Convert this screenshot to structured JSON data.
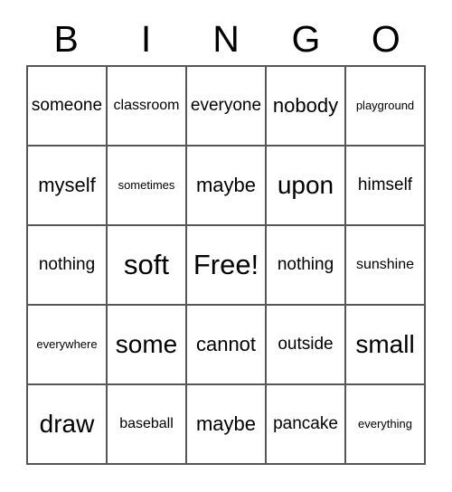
{
  "card": {
    "headers": [
      "B",
      "I",
      "N",
      "G",
      "O"
    ],
    "rows": [
      [
        {
          "text": "someone",
          "size": "m"
        },
        {
          "text": "classroom",
          "size": "s"
        },
        {
          "text": "everyone",
          "size": "m"
        },
        {
          "text": "nobody",
          "size": "l"
        },
        {
          "text": "playground",
          "size": "xs"
        }
      ],
      [
        {
          "text": "myself",
          "size": "l"
        },
        {
          "text": "sometimes",
          "size": "xs"
        },
        {
          "text": "maybe",
          "size": "l"
        },
        {
          "text": "upon",
          "size": "xl"
        },
        {
          "text": "himself",
          "size": "m"
        }
      ],
      [
        {
          "text": "nothing",
          "size": "m"
        },
        {
          "text": "soft",
          "size": "xxl"
        },
        {
          "text": "Free!",
          "size": "xxl"
        },
        {
          "text": "nothing",
          "size": "m"
        },
        {
          "text": "sunshine",
          "size": "s"
        }
      ],
      [
        {
          "text": "everywhere",
          "size": "xs"
        },
        {
          "text": "some",
          "size": "xl"
        },
        {
          "text": "cannot",
          "size": "l"
        },
        {
          "text": "outside",
          "size": "m"
        },
        {
          "text": "small",
          "size": "xl"
        }
      ],
      [
        {
          "text": "draw",
          "size": "xl"
        },
        {
          "text": "baseball",
          "size": "s"
        },
        {
          "text": "maybe",
          "size": "l"
        },
        {
          "text": "pancake",
          "size": "m"
        },
        {
          "text": "everything",
          "size": "xs"
        }
      ]
    ],
    "colors": {
      "background": "#ffffff",
      "text": "#000000",
      "grid_line": "#575757"
    }
  }
}
